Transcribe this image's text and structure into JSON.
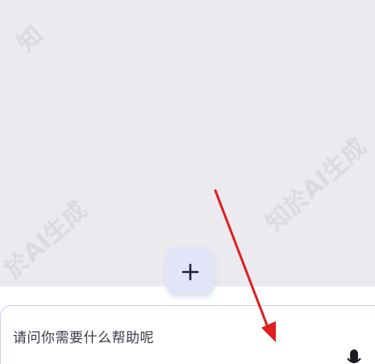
{
  "composer": {
    "placeholder": "请问你需要什么帮助呢"
  },
  "watermark": {
    "text": "知於AI生成",
    "partial_top_left": "知",
    "partial_left": "於AI生成"
  },
  "icons": {
    "add": "plus-icon",
    "mic": "microphone-icon"
  },
  "colors": {
    "background": "#eaeaef",
    "add_button": "#e2e5f8",
    "input_border": "#c8d2f4",
    "arrow": "#e01e1e"
  }
}
